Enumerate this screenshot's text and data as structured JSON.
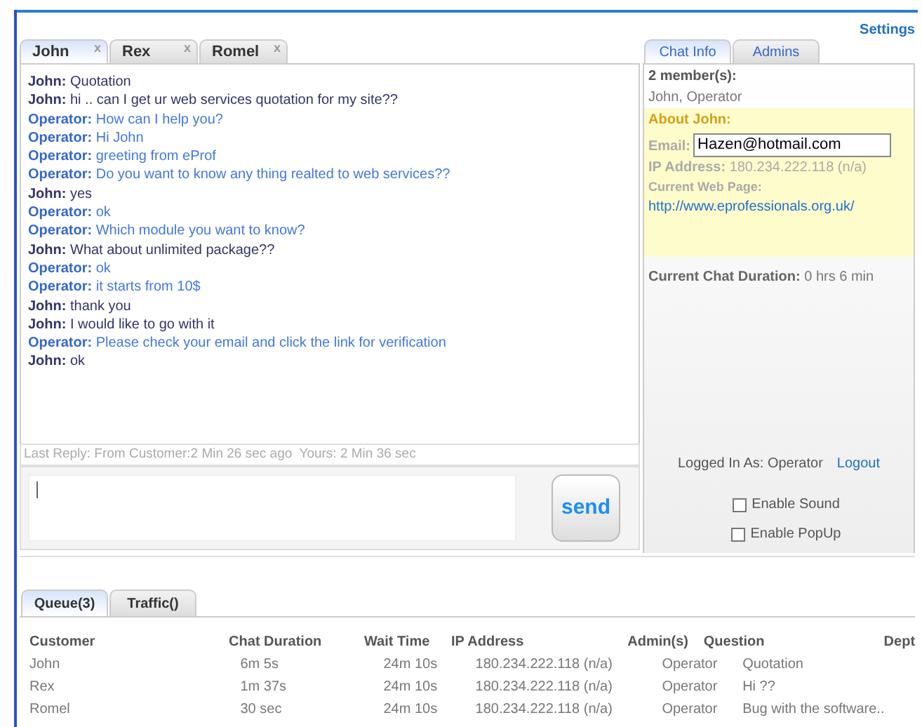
{
  "settings_link": "Settings",
  "chat_tabs": [
    {
      "label": "John",
      "close": "x",
      "selected": true
    },
    {
      "label": "Rex",
      "close": "x",
      "selected": false
    },
    {
      "label": "Romel",
      "close": "x",
      "selected": false
    }
  ],
  "messages": [
    {
      "kind": "customer",
      "sender": "John:",
      "text": "Quotation"
    },
    {
      "kind": "customer",
      "sender": "John:",
      "text": "hi .. can I get ur web services quotation for my site??"
    },
    {
      "kind": "operator",
      "sender": "Operator:",
      "text": "How can I help you?"
    },
    {
      "kind": "operator",
      "sender": "Operator:",
      "text": "Hi John"
    },
    {
      "kind": "operator",
      "sender": "Operator:",
      "text": "greeting from eProf"
    },
    {
      "kind": "operator",
      "sender": "Operator:",
      "text": "Do you want to know any thing realted to web services??"
    },
    {
      "kind": "customer",
      "sender": "John:",
      "text": "yes"
    },
    {
      "kind": "operator",
      "sender": "Operator:",
      "text": "ok"
    },
    {
      "kind": "operator",
      "sender": "Operator:",
      "text": "Which module you want to know?"
    },
    {
      "kind": "customer",
      "sender": "John:",
      "text": "What about unlimited package??"
    },
    {
      "kind": "operator",
      "sender": "Operator:",
      "text": "ok"
    },
    {
      "kind": "operator",
      "sender": "Operator:",
      "text": "it starts from 10$"
    },
    {
      "kind": "customer",
      "sender": "John:",
      "text": "thank you"
    },
    {
      "kind": "customer",
      "sender": "John:",
      "text": "I would like to go with it"
    },
    {
      "kind": "operator",
      "sender": "Operator:",
      "text": "Please check your email and click the link for verification"
    },
    {
      "kind": "customer",
      "sender": "John:",
      "text": "ok"
    }
  ],
  "last_reply": "Last Reply: From Customer:2 Min 26 sec ago  Yours: 2 Min 36 sec",
  "send_button": "send",
  "info_tabs": [
    {
      "label": "Chat Info",
      "selected": true
    },
    {
      "label": "Admins",
      "selected": false
    }
  ],
  "chat_info": {
    "members_title": "2 member(s):",
    "members": "John, Operator",
    "about_title": "About John:",
    "email_label": "Email:",
    "email_value": "Hazen@hotmail.com",
    "ip_label": "IP Address:",
    "ip_value": "180.234.222.118 (n/a)",
    "web_page_label": "Current Web Page:",
    "web_page_url": "http://www.eprofessionals.org.uk/",
    "duration_label": "Current Chat Duration:",
    "duration_value": "0 hrs 6 min"
  },
  "logged_in": "Logged In As: Operator",
  "logout_link": "Logout",
  "options": [
    {
      "label": "Enable Sound",
      "checked": false
    },
    {
      "label": "Enable PopUp",
      "checked": false
    }
  ],
  "queue_tabs": [
    {
      "label": "Queue(3)",
      "selected": true
    },
    {
      "label": "Traffic()",
      "selected": false
    }
  ],
  "table": {
    "columns": [
      "Customer",
      "Chat Duration",
      "Wait Time",
      "IP Address",
      "Admin(s)",
      "Question",
      "Dept"
    ],
    "rows": [
      [
        "John",
        "6m 5s",
        "24m 10s",
        "180.234.222.118 (n/a)",
        "Operator",
        "Quotation"
      ],
      [
        "Rex",
        "1m 37s",
        "24m 10s",
        "180.234.222.118 (n/a)",
        "Operator",
        "Hi ??"
      ],
      [
        "Romel",
        "30 sec",
        "24m 10s",
        "180.234.222.118 (n/a)",
        "Operator",
        "Bug with the software.."
      ]
    ]
  }
}
